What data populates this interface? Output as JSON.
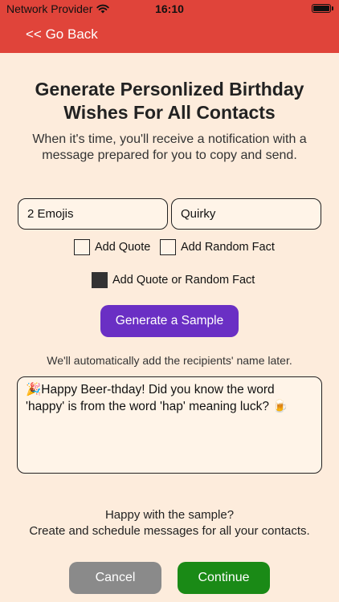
{
  "status_bar": {
    "carrier": "Network Provider",
    "time": "16:10"
  },
  "nav": {
    "back_label": "<< Go Back"
  },
  "header": {
    "title": "Generate Personlized Birthday Wishes For All Contacts",
    "subtitle": "When it's time, you'll receive a notification with a message prepared for you to copy and send."
  },
  "form": {
    "emoji_field": "2 Emojis",
    "tone_field": "Quirky",
    "add_quote_label": "Add Quote",
    "add_fact_label": "Add Random Fact",
    "add_either_label": "Add Quote or Random Fact",
    "add_quote_checked": false,
    "add_fact_checked": false,
    "add_either_checked": true
  },
  "generate_button": "Generate a Sample",
  "name_note": "We'll automatically add the recipients' name later.",
  "sample_message": "🎉Happy Beer-thday! Did you know the word 'happy' is from the word 'hap' meaning luck? 🍺",
  "footer": {
    "prompt": "Happy with the sample?\nCreate and schedule messages for all your contacts.",
    "cancel_label": "Cancel",
    "continue_label": "Continue"
  },
  "colors": {
    "topbar": "#e0443a",
    "background": "#fdecdc",
    "generate": "#6a2fc4",
    "cancel": "#8a8a8a",
    "continue": "#1a8a16"
  }
}
